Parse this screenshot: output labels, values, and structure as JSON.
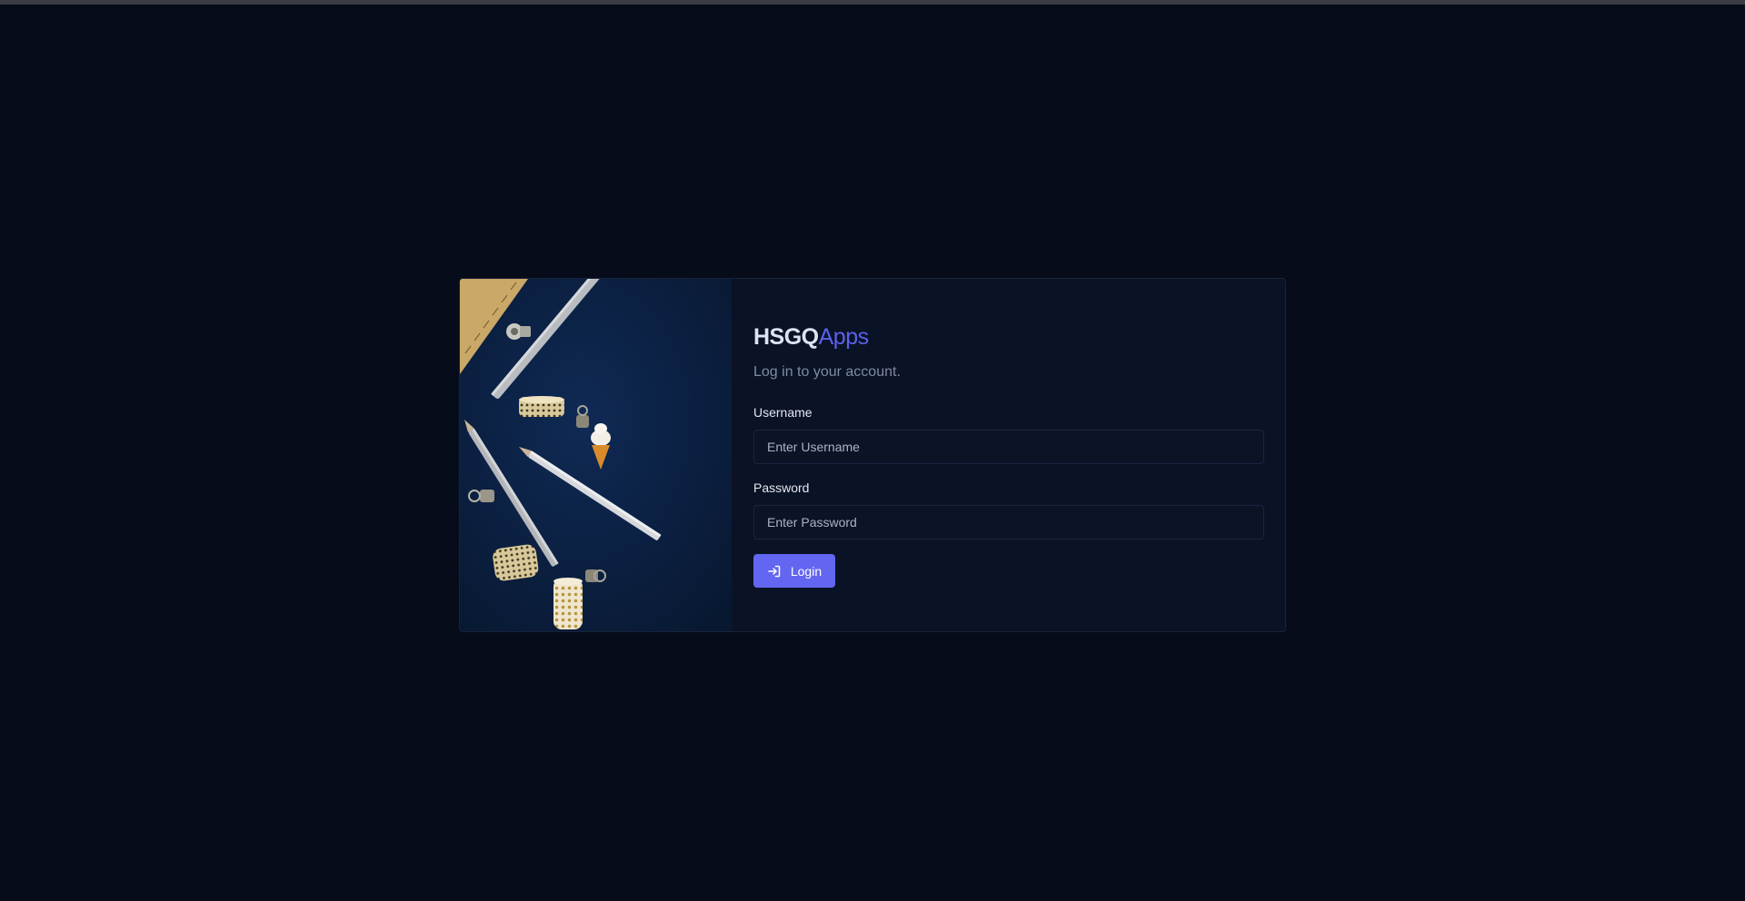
{
  "brand": {
    "main": "HSGQ",
    "accent": "Apps"
  },
  "subtitle": "Log in to your account.",
  "form": {
    "username": {
      "label": "Username",
      "placeholder": "Enter Username",
      "value": ""
    },
    "password": {
      "label": "Password",
      "placeholder": "Enter Password",
      "value": ""
    },
    "login_button": {
      "label": "Login",
      "icon": "login-icon"
    }
  },
  "colors": {
    "background": "#060c1a",
    "card": "#0a1226",
    "accent": "#6366f1",
    "brand_accent": "#5b61e8"
  },
  "photo": {
    "icon": "stationery-photo"
  }
}
